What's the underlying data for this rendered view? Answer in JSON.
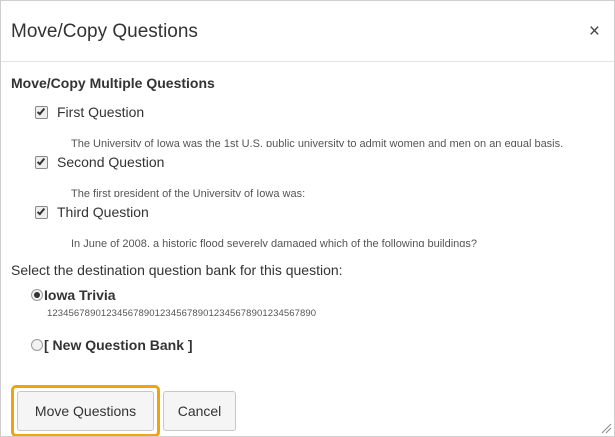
{
  "dialog": {
    "title": "Move/Copy Questions",
    "close_glyph": "×"
  },
  "body": {
    "subtitle": "Move/Copy Multiple Questions",
    "questions": [
      {
        "checked": true,
        "title": "First Question",
        "description": "The University of Iowa was the 1st U.S. public university to admit women and men on an equal basis."
      },
      {
        "checked": true,
        "title": "Second Question",
        "description": "The first president of the University of Iowa was:"
      },
      {
        "checked": true,
        "title": "Third Question",
        "description": "In June of 2008, a historic flood severely damaged which of the following buildings?"
      }
    ],
    "destination_label": "Select the destination question bank for this question:",
    "banks": [
      {
        "selected": true,
        "name": "Iowa Trivia",
        "description": "12345678901234567890123456789012345678901234567890"
      },
      {
        "selected": false,
        "name": "[ New Question Bank ]",
        "description": ""
      }
    ]
  },
  "footer": {
    "move_label": "Move Questions",
    "cancel_label": "Cancel"
  },
  "colors": {
    "focus_highlight": "#f0a30a",
    "border": "#c7c7c7"
  }
}
